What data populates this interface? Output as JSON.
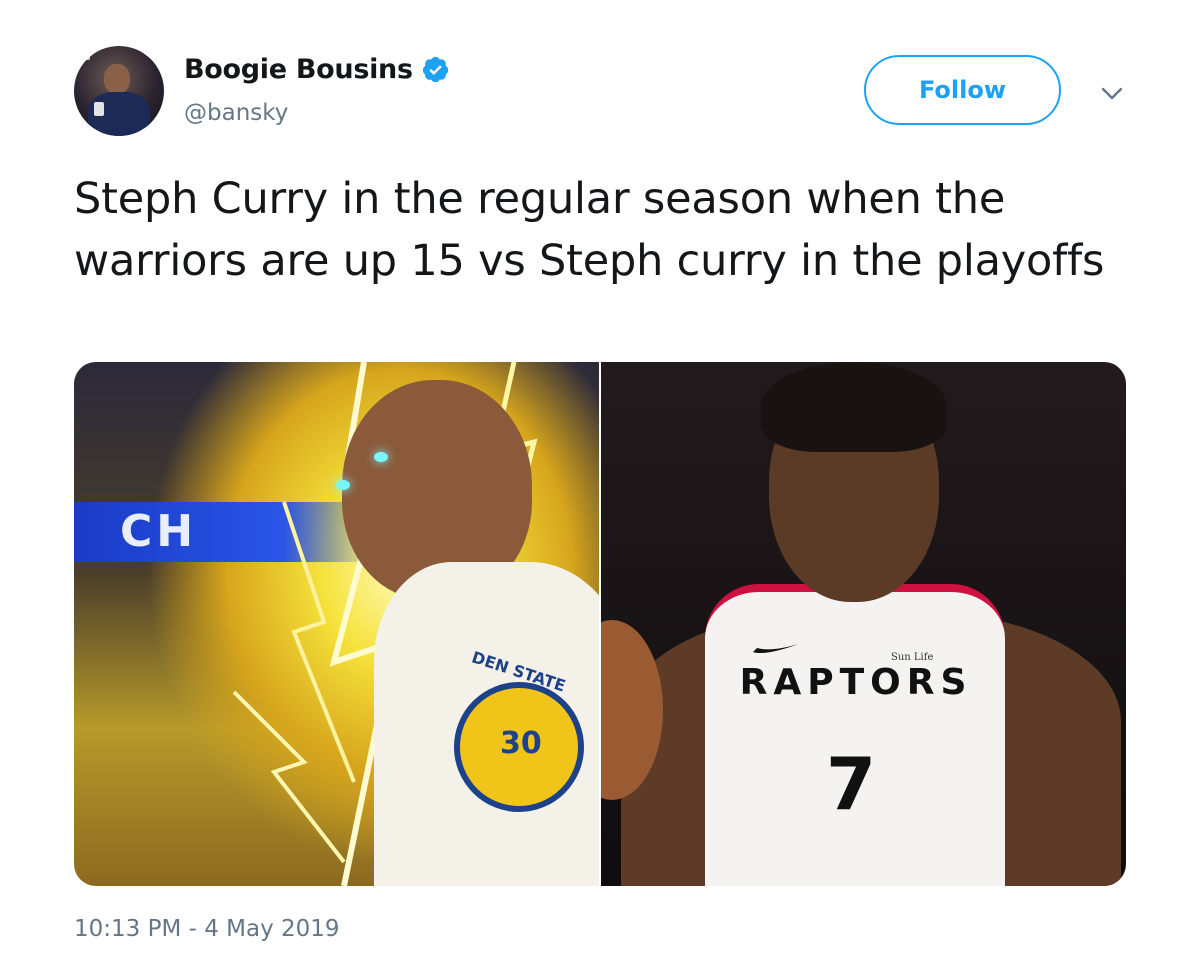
{
  "author": {
    "display_name": "Boogie Bousins",
    "handle": "@bansky",
    "verified": true
  },
  "actions": {
    "follow_label": "Follow",
    "more_icon": "chevron-down-icon"
  },
  "tweet": {
    "text": "Steph Curry in the regular season when the warriors are up 15 vs Steph curry in the playoffs",
    "timestamp": "10:13 PM - 4 May 2019"
  },
  "media": {
    "left": {
      "banner_text": "CH",
      "jersey_text": "DEN STATE",
      "number_text": "30"
    },
    "right": {
      "jersey_lettering": "RAPTORS",
      "jersey_number": "7",
      "sponsor": "Sun Life"
    }
  },
  "colors": {
    "accent": "#1da1f2",
    "text_primary": "#14171a",
    "text_secondary": "#657786"
  }
}
